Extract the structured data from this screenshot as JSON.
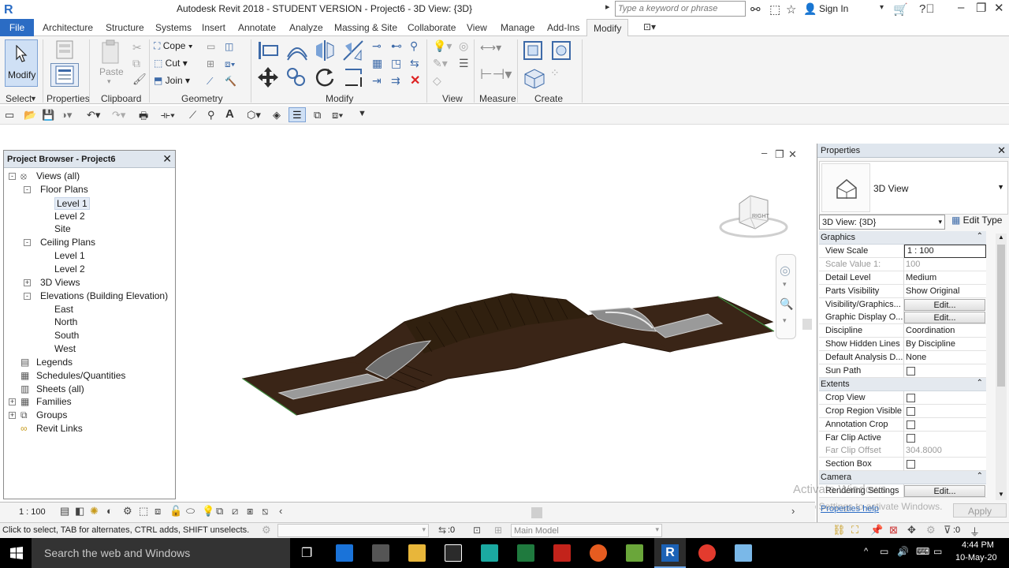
{
  "titlebar": {
    "title": "Autodesk Revit 2018 - STUDENT VERSION -    Project6 - 3D View: {3D}",
    "search_placeholder": "Type a keyword or phrase",
    "sign_in": "Sign In"
  },
  "tabs": [
    "File",
    "Architecture",
    "Structure",
    "Systems",
    "Insert",
    "Annotate",
    "Analyze",
    "Massing & Site",
    "Collaborate",
    "View",
    "Manage",
    "Add-Ins",
    "Modify"
  ],
  "ribbon": {
    "modify_label": "Modify",
    "select_label": "Select",
    "properties_label": "Properties",
    "paste_label": "Paste",
    "clipboard_label": "Clipboard",
    "cope_label": "Cope",
    "cut_label": "Cut",
    "join_label": "Join",
    "geometry_label": "Geometry",
    "modify_panel_label": "Modify",
    "view_label": "View",
    "measure_label": "Measure",
    "create_label": "Create"
  },
  "project_browser": {
    "title": "Project Browser - Project6",
    "items": [
      {
        "label": "Views (all)",
        "level": 0,
        "toggle": "-",
        "icon": "views-icon"
      },
      {
        "label": "Floor Plans",
        "level": 1,
        "toggle": "-"
      },
      {
        "label": "Level 1",
        "level": 2,
        "selected": true
      },
      {
        "label": "Level 2",
        "level": 2
      },
      {
        "label": "Site",
        "level": 2
      },
      {
        "label": "Ceiling Plans",
        "level": 1,
        "toggle": "-"
      },
      {
        "label": "Level 1",
        "level": 2
      },
      {
        "label": "Level 2",
        "level": 2
      },
      {
        "label": "3D Views",
        "level": 1,
        "toggle": "+"
      },
      {
        "label": "Elevations (Building Elevation)",
        "level": 1,
        "toggle": "-"
      },
      {
        "label": "East",
        "level": 2
      },
      {
        "label": "North",
        "level": 2
      },
      {
        "label": "South",
        "level": 2
      },
      {
        "label": "West",
        "level": 2
      },
      {
        "label": "Legends",
        "level": 0,
        "icon": "legend-icon"
      },
      {
        "label": "Schedules/Quantities",
        "level": 0,
        "icon": "schedule-icon"
      },
      {
        "label": "Sheets (all)",
        "level": 0,
        "icon": "sheet-icon"
      },
      {
        "label": "Families",
        "level": 0,
        "toggle": "+",
        "icon": "family-icon"
      },
      {
        "label": "Groups",
        "level": 0,
        "toggle": "+",
        "icon": "group-icon"
      },
      {
        "label": "Revit Links",
        "level": 0,
        "icon": "link-icon"
      }
    ]
  },
  "viewcube": {
    "face_label": "RIGHT"
  },
  "properties": {
    "title": "Properties",
    "type_name": "3D View",
    "view_selector": "3D View: {3D}",
    "edit_type": "Edit Type",
    "rows": [
      {
        "kind": "group",
        "label": "Graphics"
      },
      {
        "kind": "input",
        "label": "View Scale",
        "value": "1 : 100"
      },
      {
        "kind": "disabled",
        "label": "Scale Value    1:",
        "value": "100"
      },
      {
        "kind": "text",
        "label": "Detail Level",
        "value": "Medium"
      },
      {
        "kind": "text",
        "label": "Parts Visibility",
        "value": "Show Original"
      },
      {
        "kind": "button",
        "label": "Visibility/Graphics...",
        "value": "Edit..."
      },
      {
        "kind": "button",
        "label": "Graphic Display O...",
        "value": "Edit..."
      },
      {
        "kind": "text",
        "label": "Discipline",
        "value": "Coordination"
      },
      {
        "kind": "text",
        "label": "Show Hidden Lines",
        "value": "By Discipline"
      },
      {
        "kind": "text",
        "label": "Default Analysis D...",
        "value": "None"
      },
      {
        "kind": "check",
        "label": "Sun Path",
        "value": ""
      },
      {
        "kind": "group",
        "label": "Extents"
      },
      {
        "kind": "check",
        "label": "Crop View",
        "value": ""
      },
      {
        "kind": "check",
        "label": "Crop Region Visible",
        "value": ""
      },
      {
        "kind": "check",
        "label": "Annotation Crop",
        "value": ""
      },
      {
        "kind": "check",
        "label": "Far Clip Active",
        "value": ""
      },
      {
        "kind": "disabled",
        "label": "Far Clip Offset",
        "value": "304.8000"
      },
      {
        "kind": "check",
        "label": "Section Box",
        "value": ""
      },
      {
        "kind": "group",
        "label": "Camera"
      },
      {
        "kind": "button",
        "label": "Rendering Settings",
        "value": "Edit..."
      }
    ],
    "help_link": "Properties help",
    "apply": "Apply"
  },
  "watermark": {
    "line1": "Activate Windows",
    "line2": "Go to Settings to activate Windows."
  },
  "view_control": {
    "scale": "1 : 100"
  },
  "status": {
    "hint": "Click to select, TAB for alternates, CTRL adds, SHIFT unselects.",
    "zero1": ":0",
    "model": "Main Model",
    "zero2": ":0"
  },
  "taskbar": {
    "search": "Search the web and Windows",
    "time": "4:44 PM",
    "date": "10-May-20"
  }
}
